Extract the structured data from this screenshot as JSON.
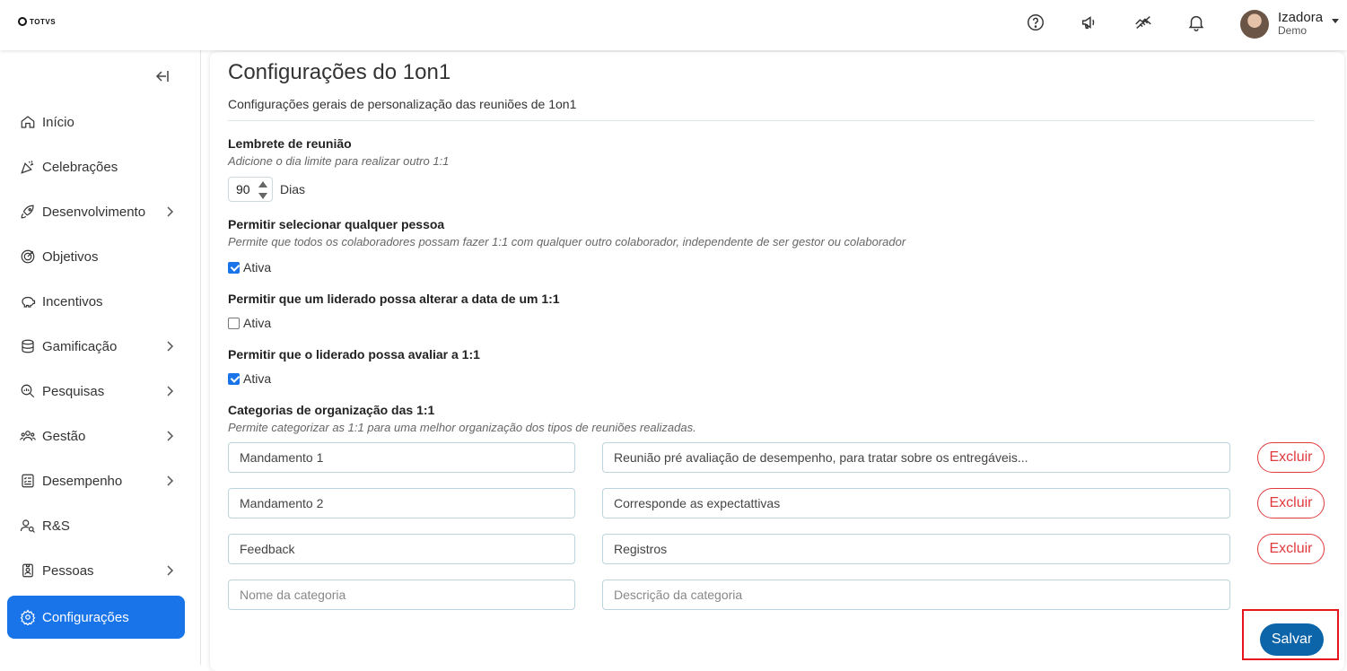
{
  "brand": {
    "logo_text": "TOTVS"
  },
  "user": {
    "name": "Izadora",
    "subtitle": "Demo"
  },
  "sidebar": {
    "items": [
      {
        "label": "Início",
        "icon": "home-icon",
        "has_submenu": false
      },
      {
        "label": "Celebrações",
        "icon": "party-popper-icon",
        "has_submenu": false
      },
      {
        "label": "Desenvolvimento",
        "icon": "rocket-icon",
        "has_submenu": true
      },
      {
        "label": "Objetivos",
        "icon": "target-icon",
        "has_submenu": false
      },
      {
        "label": "Incentivos",
        "icon": "piggy-bank-icon",
        "has_submenu": false
      },
      {
        "label": "Gamificação",
        "icon": "coins-icon",
        "has_submenu": true
      },
      {
        "label": "Pesquisas",
        "icon": "search-chart-icon",
        "has_submenu": true
      },
      {
        "label": "Gestão",
        "icon": "users-group-icon",
        "has_submenu": true
      },
      {
        "label": "Desempenho",
        "icon": "checklist-icon",
        "has_submenu": true
      },
      {
        "label": "R&S",
        "icon": "user-search-icon",
        "has_submenu": false
      },
      {
        "label": "Pessoas",
        "icon": "id-badge-icon",
        "has_submenu": true
      },
      {
        "label": "Configurações",
        "icon": "gear-icon",
        "has_submenu": false,
        "active": true
      }
    ]
  },
  "page": {
    "title": "Configurações do 1on1",
    "subtitle": "Configurações gerais de personalização das reuniões de 1on1"
  },
  "reminder": {
    "title": "Lembrete de reunião",
    "description": "Adicione o dia limite para realizar outro 1:1",
    "value": "90",
    "unit": "Dias"
  },
  "toggles": [
    {
      "title": "Permitir selecionar qualquer pessoa",
      "description": "Permite que todos os colaboradores possam fazer 1:1 com qualquer outro colaborador, independente de ser gestor ou colaborador",
      "label": "Ativa",
      "checked": true
    },
    {
      "title": "Permitir que um liderado possa alterar a data de um 1:1",
      "description": "",
      "label": "Ativa",
      "checked": false
    },
    {
      "title": "Permitir que o liderado possa avaliar a 1:1",
      "description": "",
      "label": "Ativa",
      "checked": true
    }
  ],
  "categories": {
    "title": "Categorias de organização das 1:1",
    "description": "Permite categorizar as 1:1 para uma melhor organização dos tipos de reuniões realizadas.",
    "rows": [
      {
        "name": "Mandamento 1",
        "description": "Reunião pré avaliação de desempenho, para tratar sobre os entregáveis...",
        "delete_label": "Excluir"
      },
      {
        "name": "Mandamento 2",
        "description": "Corresponde as expectattivas",
        "delete_label": "Excluir"
      },
      {
        "name": "Feedback",
        "description": "Registros",
        "delete_label": "Excluir"
      }
    ],
    "new_name_placeholder": "Nome da categoria",
    "new_description_placeholder": "Descrição da categoria"
  },
  "actions": {
    "save_label": "Salvar"
  },
  "colors": {
    "primary": "#1874e8",
    "save": "#0c65a8",
    "danger": "#e0393e",
    "highlight": "#e8141c"
  }
}
